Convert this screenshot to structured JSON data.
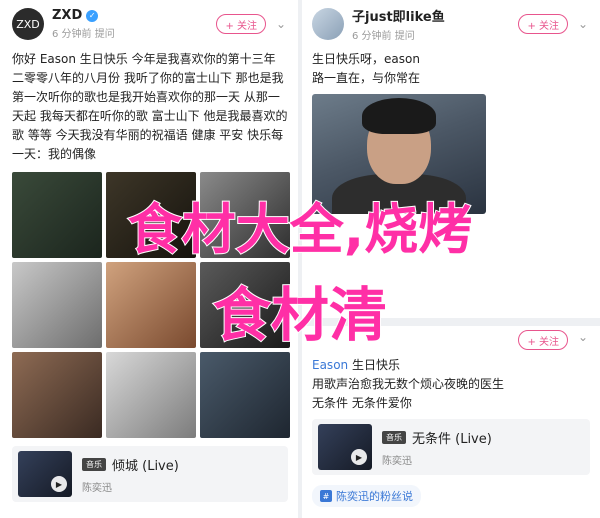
{
  "left_post": {
    "username": "ZXD",
    "time": "6 分钟前",
    "mention_word": "提问",
    "follow_label": "+ 关注",
    "body_pre": "你好 Eason 生日快乐 今年是我喜欢你的第十三年 二零零八年的八月份 我听了你的富士山下 那也是我第一次听你的歌也是我开始喜欢你的那一天 从那一天起 我每天都在听你的歌 富士山下 他是我最喜欢的歌 等等 今天我没有华丽的祝福语 健康 平安 快乐每一天：我的偶像",
    "music": {
      "tag": "音乐",
      "title": "倾城 (Live)",
      "artist": "陈奕迅"
    }
  },
  "right_post": {
    "username": "子just即like鱼",
    "time": "6 分钟前",
    "mention_word": "提问",
    "follow_label": "+ 关注",
    "body_line1": "生日快乐呀，eason",
    "body_line2": "路一直在，与你常在",
    "second": {
      "mention": "Eason",
      "line1_suffix": " 生日快乐",
      "line2": "用歌声治愈我无数个烦心夜晚的医生",
      "line3": "无条件 无条件爱你",
      "follow_label": "+ 关注",
      "music": {
        "tag": "音乐",
        "title": "无条件 (Live)",
        "artist": "陈奕迅"
      },
      "link_label": "陈奕迅的粉丝说"
    }
  },
  "overlay": {
    "line1": "食材大全,烧烤",
    "line2": "食材清"
  },
  "colors": {
    "overlay_text": "#ff2fa6",
    "accent": "#e8558d",
    "link": "#3a78d6"
  }
}
